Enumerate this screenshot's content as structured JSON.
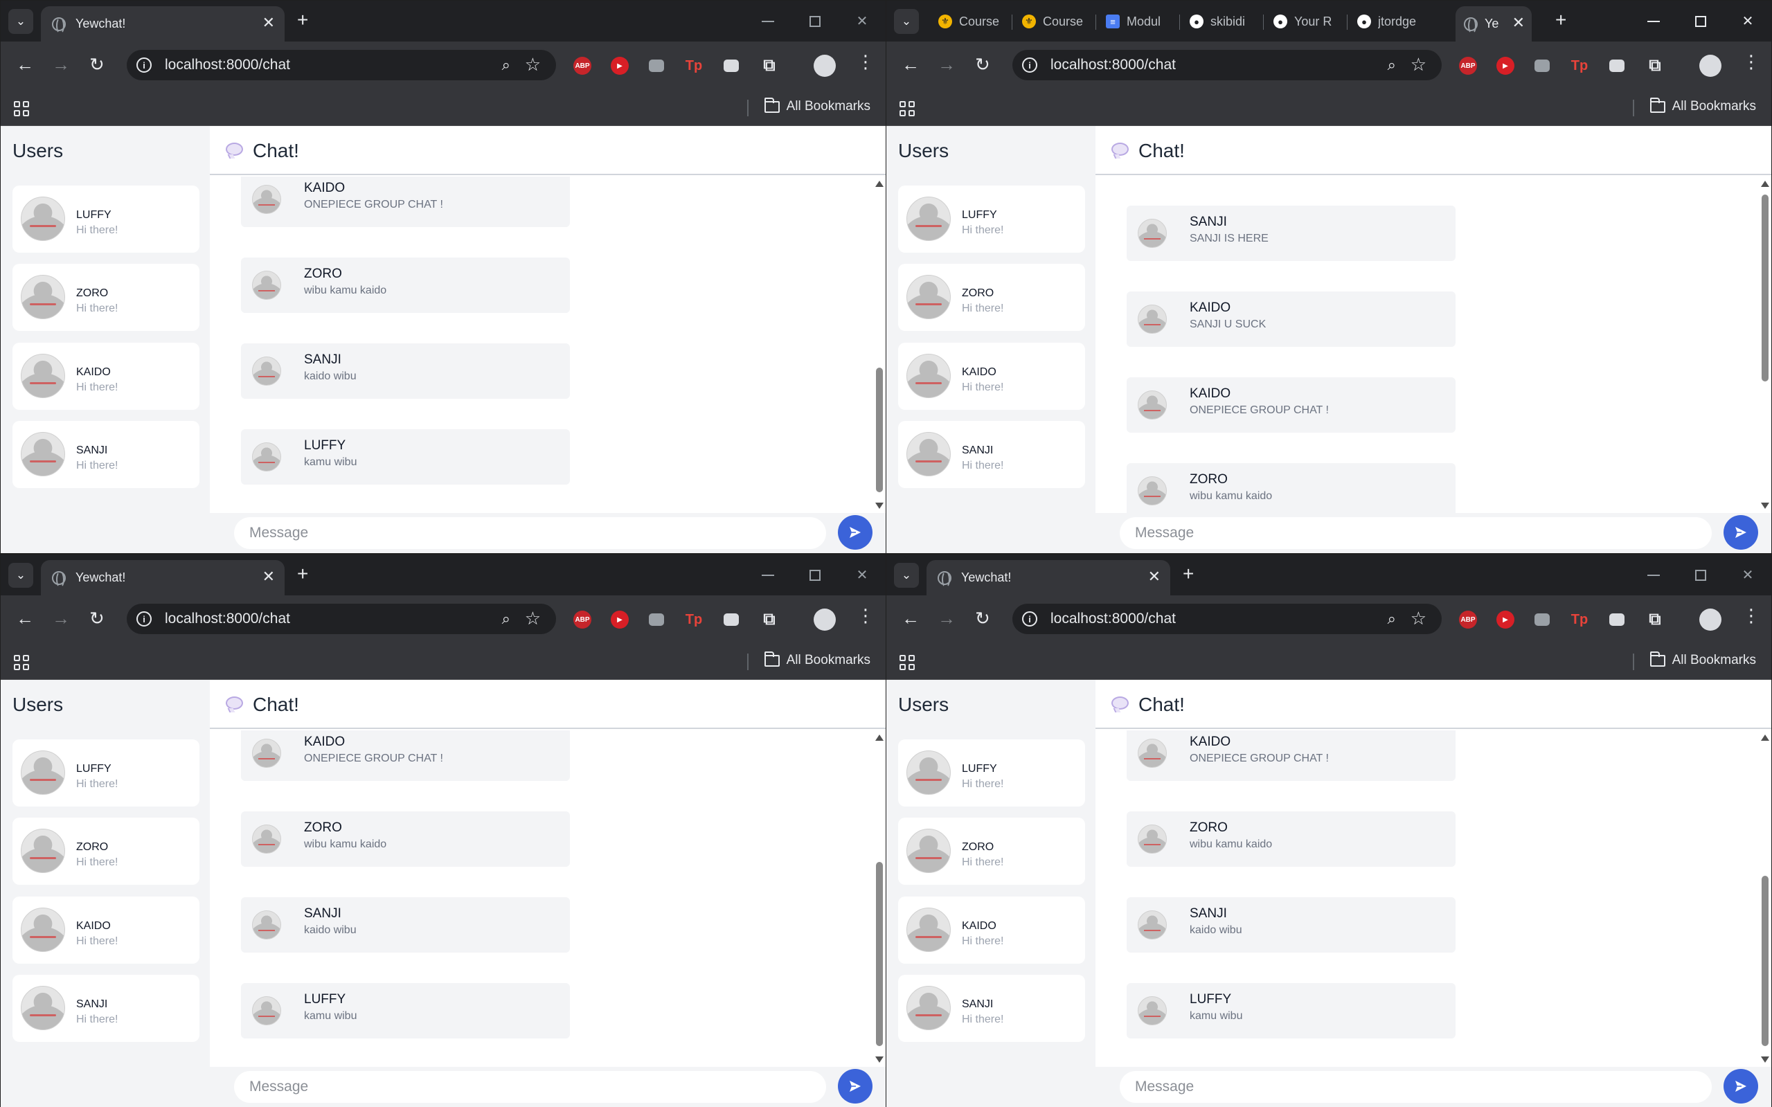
{
  "windows": [
    {
      "tab_title": "Yewchat!",
      "url": "localhost:8000/chat",
      "bookmarks_label": "All Bookmarks",
      "users_title": "Users",
      "chat_title": "Chat!",
      "message_placeholder": "Message",
      "users": [
        {
          "name": "LUFFY",
          "status": "Hi there!"
        },
        {
          "name": "ZORO",
          "status": "Hi there!"
        },
        {
          "name": "KAIDO",
          "status": "Hi there!"
        },
        {
          "name": "SANJI",
          "status": "Hi there!"
        }
      ],
      "messages": [
        {
          "from": "KAIDO",
          "text": "ONEPIECE GROUP CHAT !"
        },
        {
          "from": "ZORO",
          "text": "wibu kamu kaido"
        },
        {
          "from": "SANJI",
          "text": "kaido wibu"
        },
        {
          "from": "LUFFY",
          "text": "kamu wibu"
        }
      ]
    },
    {
      "tabs": [
        {
          "title": "Course",
          "icon": "course-icon"
        },
        {
          "title": "Course",
          "icon": "course-icon"
        },
        {
          "title": "Modul",
          "icon": "doc-icon"
        },
        {
          "title": "skibidi",
          "icon": "github-icon"
        },
        {
          "title": "Your R",
          "icon": "github-icon"
        },
        {
          "title": "jtordge",
          "icon": "github-icon"
        },
        {
          "title": "Ye",
          "icon": "globe-icon"
        }
      ],
      "url": "localhost:8000/chat",
      "bookmarks_label": "All Bookmarks",
      "users_title": "Users",
      "chat_title": "Chat!",
      "message_placeholder": "Message",
      "users": [
        {
          "name": "LUFFY",
          "status": "Hi there!"
        },
        {
          "name": "ZORO",
          "status": "Hi there!"
        },
        {
          "name": "KAIDO",
          "status": "Hi there!"
        },
        {
          "name": "SANJI",
          "status": "Hi there!"
        }
      ],
      "messages": [
        {
          "from": "SANJI",
          "text": "SANJI IS HERE"
        },
        {
          "from": "KAIDO",
          "text": "SANJI U SUCK"
        },
        {
          "from": "KAIDO",
          "text": "ONEPIECE GROUP CHAT !"
        },
        {
          "from": "ZORO",
          "text": "wibu kamu kaido"
        }
      ]
    },
    {
      "tab_title": "Yewchat!",
      "url": "localhost:8000/chat",
      "bookmarks_label": "All Bookmarks",
      "users_title": "Users",
      "chat_title": "Chat!",
      "message_placeholder": "Message",
      "users": [
        {
          "name": "LUFFY",
          "status": "Hi there!"
        },
        {
          "name": "ZORO",
          "status": "Hi there!"
        },
        {
          "name": "KAIDO",
          "status": "Hi there!"
        },
        {
          "name": "SANJI",
          "status": "Hi there!"
        }
      ],
      "messages": [
        {
          "from": "KAIDO",
          "text": "ONEPIECE GROUP CHAT !"
        },
        {
          "from": "ZORO",
          "text": "wibu kamu kaido"
        },
        {
          "from": "SANJI",
          "text": "kaido wibu"
        },
        {
          "from": "LUFFY",
          "text": "kamu wibu"
        }
      ]
    },
    {
      "tab_title": "Yewchat!",
      "url": "localhost:8000/chat",
      "bookmarks_label": "All Bookmarks",
      "users_title": "Users",
      "chat_title": "Chat!",
      "message_placeholder": "Message",
      "users": [
        {
          "name": "LUFFY",
          "status": "Hi there!"
        },
        {
          "name": "ZORO",
          "status": "Hi there!"
        },
        {
          "name": "KAIDO",
          "status": "Hi there!"
        },
        {
          "name": "SANJI",
          "status": "Hi there!"
        }
      ],
      "messages": [
        {
          "from": "KAIDO",
          "text": "ONEPIECE GROUP CHAT !"
        },
        {
          "from": "ZORO",
          "text": "wibu kamu kaido"
        },
        {
          "from": "SANJI",
          "text": "kaido wibu"
        },
        {
          "from": "LUFFY",
          "text": "kamu wibu"
        }
      ]
    }
  ],
  "colors": {
    "send_button": "#3b63d9",
    "sidebar_bg": "#f3f4f6",
    "message_bubble": "#f3f4f6"
  }
}
